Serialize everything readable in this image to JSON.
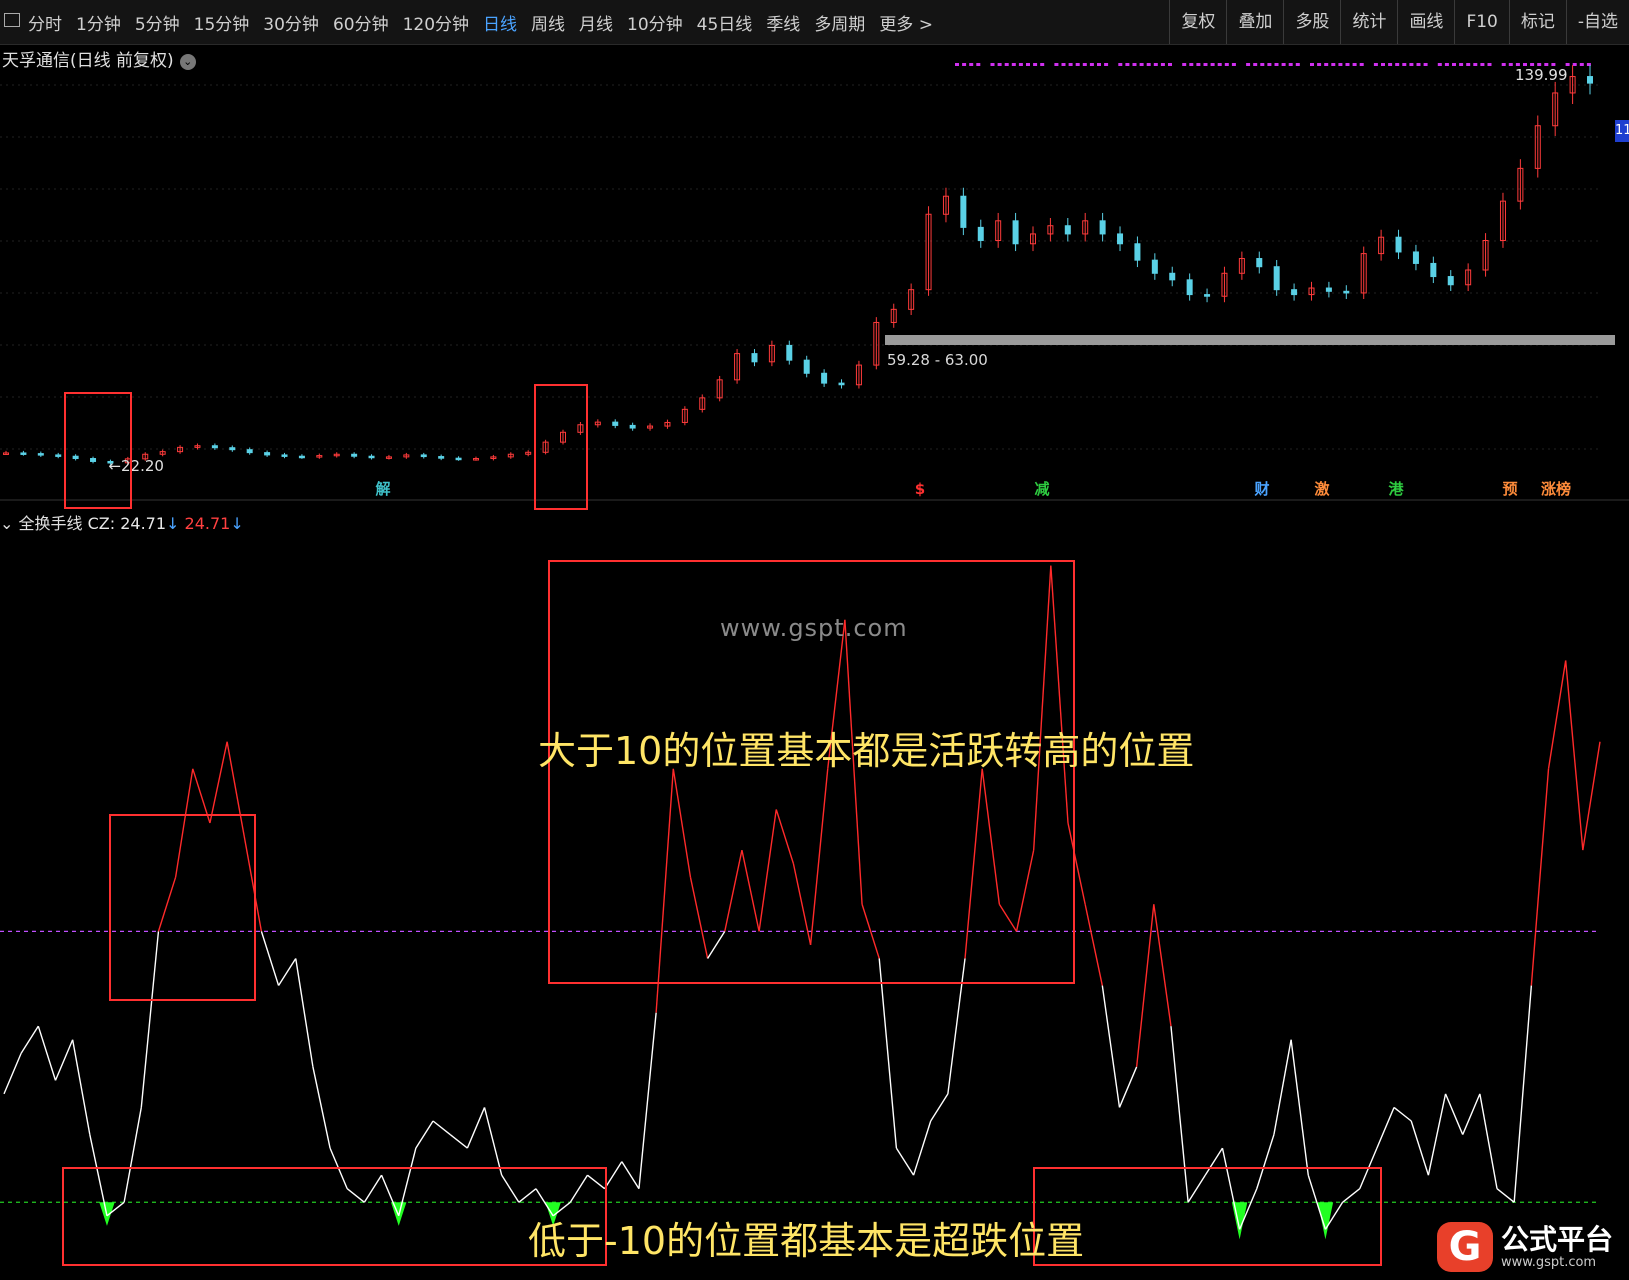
{
  "toolbar": {
    "periods": [
      "分时",
      "1分钟",
      "5分钟",
      "15分钟",
      "30分钟",
      "60分钟",
      "120分钟",
      "日线",
      "周线",
      "月线",
      "10分钟",
      "45日线",
      "季线",
      "多周期",
      "更多 >"
    ],
    "active_period": "日线",
    "right_buttons": [
      "复权",
      "叠加",
      "多股",
      "统计",
      "画线",
      "F10",
      "标记",
      "-自选"
    ]
  },
  "stock": {
    "title": "天孚通信(日线 前复权)",
    "low_label": "←22.20",
    "high_label": "139.99",
    "right_tag": "11",
    "gap_band_label": "59.28 - 63.00"
  },
  "events": [
    {
      "label": "解",
      "color": "#3fc1c9"
    },
    {
      "label": "$",
      "color": "#ff3030"
    },
    {
      "label": "减",
      "color": "#2ecc40"
    },
    {
      "label": "财",
      "color": "#4aa3ff"
    },
    {
      "label": "激",
      "color": "#ff8c3a"
    },
    {
      "label": "港",
      "color": "#2ecc40"
    },
    {
      "label": "预",
      "color": "#ff8c3a"
    },
    {
      "label": "涨榜",
      "color": "#ff8c3a"
    }
  ],
  "indicator": {
    "name": "全换手线",
    "cz_label": "CZ: 24.71",
    "value": "24.71"
  },
  "watermark": "www.gspt.com",
  "annotations": {
    "high_text": "大于10的位置基本都是活跃转高的位置",
    "low_text": "低于-10的位置都基本是超跌位置"
  },
  "logo": {
    "mark": "G",
    "name": "公式平台",
    "url": "www.gspt.com"
  },
  "colors": {
    "up": "#ff3b3b",
    "down": "#5ad1e6",
    "line_high": "#ff2a2a",
    "line_normal": "#ffffff",
    "oversold": "#22ff22",
    "upper_ref": "#c050ff",
    "lower_ref": "#22cc22",
    "box": "#ff3030"
  },
  "chart_data": [
    {
      "type": "candlestick",
      "title": "天孚通信(日线 前复权)",
      "series": [
        {
          "values": [
            25.2,
            25.0,
            24.6,
            24.2,
            23.5,
            22.6,
            22.2,
            23.4,
            24.8,
            25.6,
            26.9,
            27.4,
            26.8,
            26.2,
            25.3,
            24.6,
            24.2,
            24.0,
            24.4,
            24.8,
            24.2,
            23.8,
            24.0,
            24.6,
            24.1,
            23.6,
            23.4,
            23.5,
            24.0,
            24.8,
            25.4,
            28.5,
            31.5,
            33.8,
            34.6,
            33.6,
            32.8,
            33.4,
            34.5,
            38.5,
            42.0,
            47.5,
            55.5,
            53.0,
            58.0,
            53.5,
            49.5,
            46.5,
            46.0,
            52.0,
            65.0,
            69.0,
            75.0,
            98.0,
            103.5,
            94.0,
            90.0,
            96.0,
            89.0,
            92.0,
            94.5,
            92.0,
            96.0,
            92.0,
            89.0,
            84.0,
            80.0,
            78.0,
            73.5,
            73.0,
            80.0,
            84.5,
            82.0,
            75.0,
            73.5,
            75.5,
            74.5,
            74.0,
            86.0,
            91.0,
            86.5,
            83.0,
            79.0,
            76.5,
            81.0,
            90.0,
            102.0,
            112.0,
            125.0,
            135.0,
            140.0,
            138.0
          ]
        }
      ],
      "low_marker": 22.2,
      "high_marker": 139.99,
      "gap_band": [
        59.28,
        63.0
      ]
    },
    {
      "type": "line",
      "title": "全换手线",
      "reference_lines": [
        10,
        -10
      ],
      "series": [
        {
          "values": [
            -2,
            1,
            3,
            -1,
            2,
            -5,
            -11,
            -10,
            -3,
            10,
            14,
            22,
            18,
            24,
            17,
            10,
            6,
            8,
            0,
            -6,
            -9,
            -10,
            -8,
            -11,
            -6,
            -4,
            -5,
            -6,
            -3,
            -8,
            -10,
            -9,
            -11,
            -10,
            -8,
            -9,
            -7,
            -9,
            4,
            22,
            14,
            8,
            10,
            16,
            10,
            19,
            15,
            9,
            22,
            33,
            12,
            8,
            -6,
            -8,
            -4,
            -2,
            8,
            22,
            12,
            10,
            16,
            37,
            18,
            12,
            6,
            -3,
            0,
            12,
            3,
            -10,
            -8,
            -6,
            -12,
            -9,
            -5,
            2,
            -8,
            -12,
            -10,
            -9,
            -6,
            -3,
            -4,
            -8,
            -2,
            -5,
            -2,
            -9,
            -10,
            6,
            22,
            30,
            16,
            24
          ]
        }
      ],
      "current_value": 24.71
    }
  ]
}
